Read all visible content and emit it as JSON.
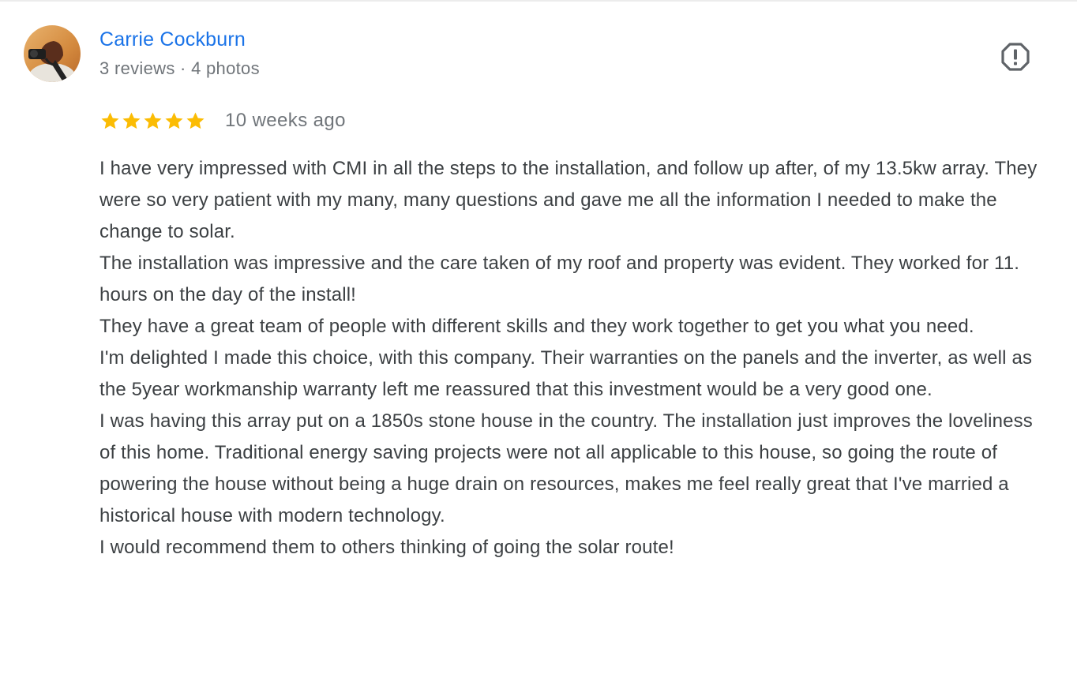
{
  "review": {
    "author": {
      "name": "Carrie Cockburn",
      "meta": "3 reviews · 4 photos",
      "avatar_icon": "profile-photo"
    },
    "report_icon": "flag-report-icon",
    "rating": 5,
    "rating_max": 5,
    "star_color": "#fbbc04",
    "date": "10 weeks ago",
    "paragraphs": [
      "I have very impressed with CMI in all the steps to the installation, and follow up after, of my 13.5kw array. They were so very patient with my many, many questions and gave me all the information I needed to make the change to solar.",
      "The installation was impressive and the care taken of my roof and property was evident. They worked for 11. hours on the day of the install!",
      "They have a great team of people with different skills and they work together to get you what you need.",
      "I'm delighted I made this choice, with this company. Their warranties on the panels and the inverter, as well as the 5year workmanship warranty left me reassured that this investment would be a very good one.",
      "I was having this array put on a 1850s stone house in the country. The installation just improves the loveliness of this home. Traditional energy saving projects were not all applicable to this house, so going the route of powering the house without being a huge drain on resources, makes me feel really great that I've married a historical house with modern technology.",
      "I would recommend them to others thinking of going the solar route!"
    ],
    "colors": {
      "name_link": "#1a73e8",
      "meta_text": "#70757a",
      "body_text": "#3c4043"
    }
  }
}
